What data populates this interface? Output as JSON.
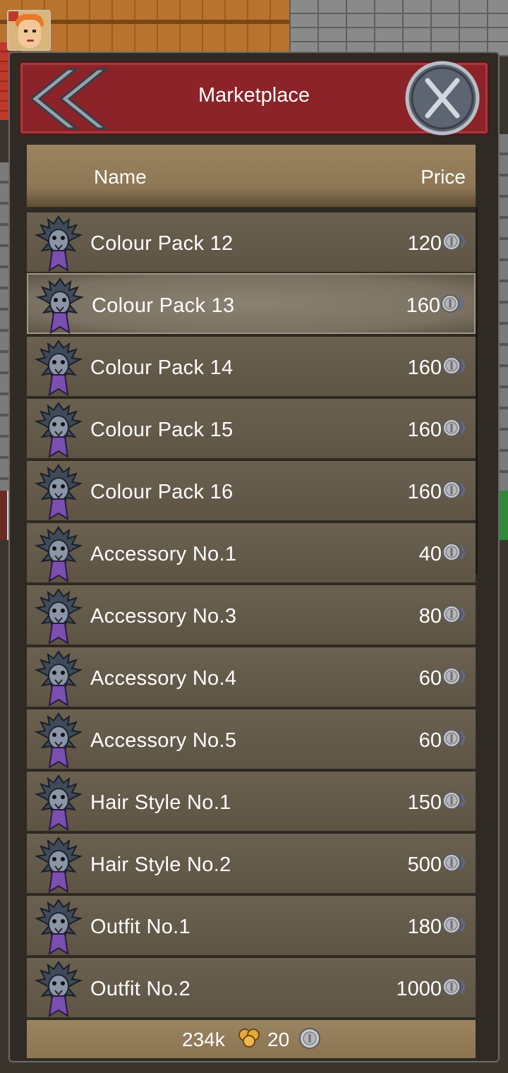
{
  "dialog": {
    "title": "Marketplace"
  },
  "table": {
    "headers": {
      "name": "Name",
      "price": "Price"
    }
  },
  "items": [
    {
      "name": "Colour Pack 12",
      "price": "120",
      "selected": false
    },
    {
      "name": "Colour Pack 13",
      "price": "160",
      "selected": true
    },
    {
      "name": "Colour Pack 14",
      "price": "160",
      "selected": false
    },
    {
      "name": "Colour Pack 15",
      "price": "160",
      "selected": false
    },
    {
      "name": "Colour Pack 16",
      "price": "160",
      "selected": false
    },
    {
      "name": "Accessory No.1",
      "price": "40",
      "selected": false
    },
    {
      "name": "Accessory No.3",
      "price": "80",
      "selected": false
    },
    {
      "name": "Accessory No.4",
      "price": "60",
      "selected": false
    },
    {
      "name": "Accessory No.5",
      "price": "60",
      "selected": false
    },
    {
      "name": "Hair Style No.1",
      "price": "150",
      "selected": false
    },
    {
      "name": "Hair Style No.2",
      "price": "500",
      "selected": false
    },
    {
      "name": "Outfit No.1",
      "price": "180",
      "selected": false
    },
    {
      "name": "Outfit No.2",
      "price": "1000",
      "selected": false
    }
  ],
  "footer": {
    "gold": "234k",
    "coins": "20"
  },
  "icons": {
    "item": "creature-portrait-icon",
    "price": "silver-coin-icon",
    "gold": "gold-coins-icon",
    "back": "double-chevron-left-icon",
    "close": "close-x-icon"
  },
  "colors": {
    "title_bar": "#8b2329",
    "header": "#9a8462",
    "row": "#5e5444",
    "text": "#ffffff"
  }
}
